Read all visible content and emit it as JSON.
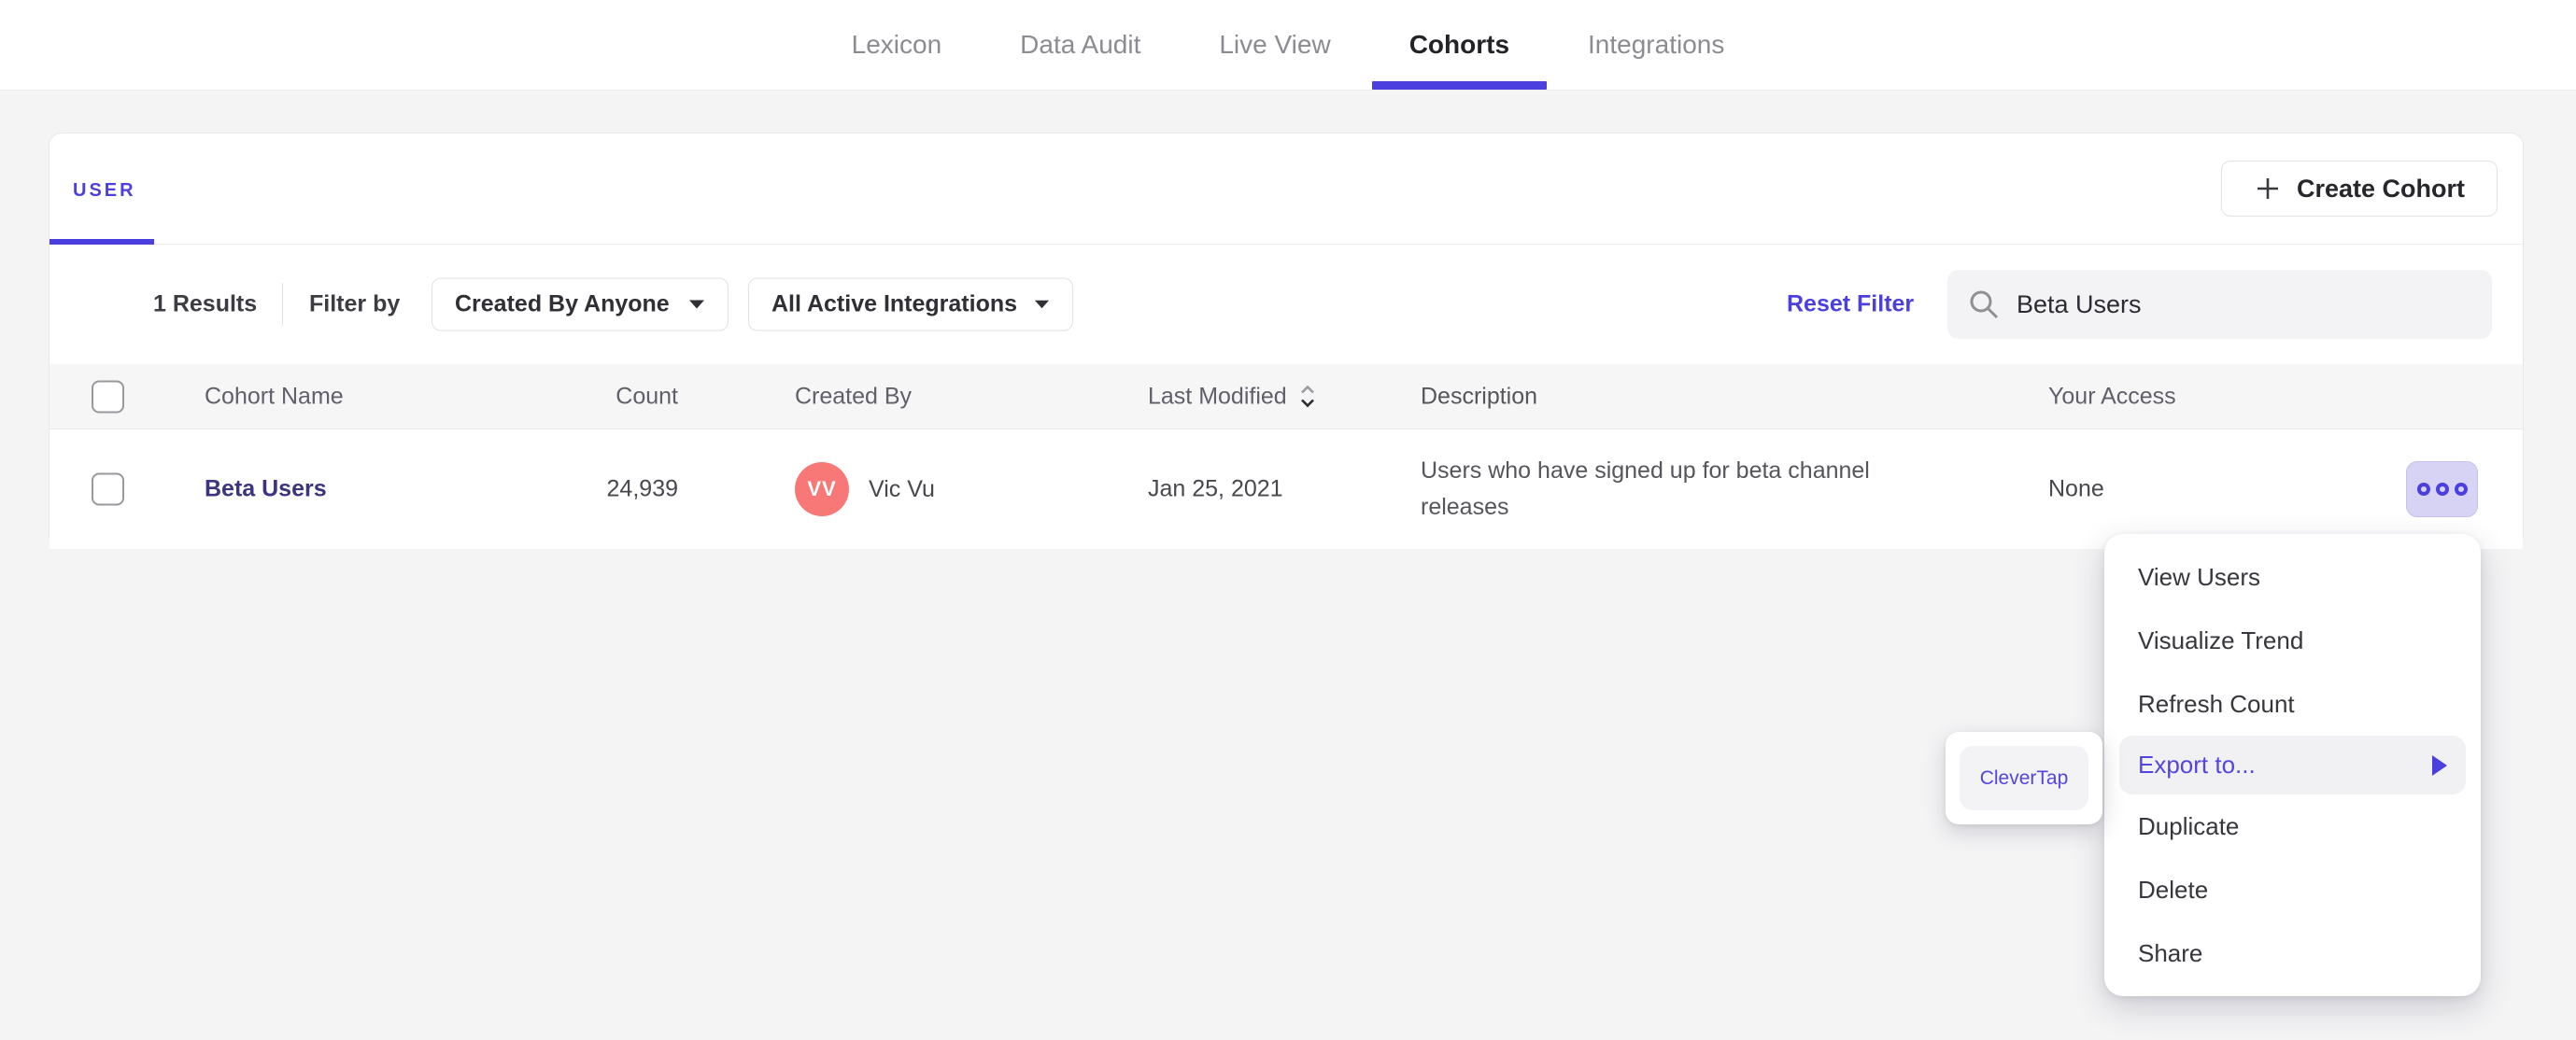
{
  "nav": {
    "tabs": [
      {
        "label": "Lexicon",
        "active": false
      },
      {
        "label": "Data Audit",
        "active": false
      },
      {
        "label": "Live View",
        "active": false
      },
      {
        "label": "Cohorts",
        "active": true
      },
      {
        "label": "Integrations",
        "active": false
      }
    ]
  },
  "cohorts_panel": {
    "user_tab_label": "USER",
    "create_cohort_label": "Create Cohort",
    "filter_bar": {
      "results_count": "1 Results",
      "filter_by_label": "Filter by",
      "created_by_dropdown_value": "Created By Anyone",
      "integrations_dropdown_value": "All Active Integrations",
      "reset_filter_label": "Reset Filter",
      "search_value": "Beta Users"
    },
    "table": {
      "headers": {
        "cohort_name": "Cohort Name",
        "count": "Count",
        "created_by": "Created By",
        "last_modified": "Last Modified",
        "description": "Description",
        "your_access": "Your Access"
      },
      "row": {
        "cohort_name": "Beta Users",
        "count": "24,939",
        "creator_initials": "VV",
        "creator_name": "Vic Vu",
        "last_modified": "Jan 25, 2021",
        "description": "Users who have signed up for beta channel releases",
        "your_access": "None"
      }
    }
  },
  "context_menu": {
    "items": [
      {
        "label": "View Users"
      },
      {
        "label": "Visualize Trend"
      },
      {
        "label": "Refresh Count"
      },
      {
        "label": "Export to...",
        "highlighted": true,
        "has_submenu": true
      },
      {
        "label": "Duplicate"
      },
      {
        "label": "Delete"
      },
      {
        "label": "Share"
      }
    ],
    "submenu": {
      "items": [
        {
          "label": "CleverTap"
        }
      ]
    }
  },
  "colors": {
    "accent_purple": "#4c3fe0",
    "cohort_link": "#3c3480",
    "avatar_coral": "#f87878",
    "page_background": "#f4f4f5",
    "menu_highlight_bg": "#f1f1f3",
    "more_button_bg": "#d6d3f4"
  }
}
